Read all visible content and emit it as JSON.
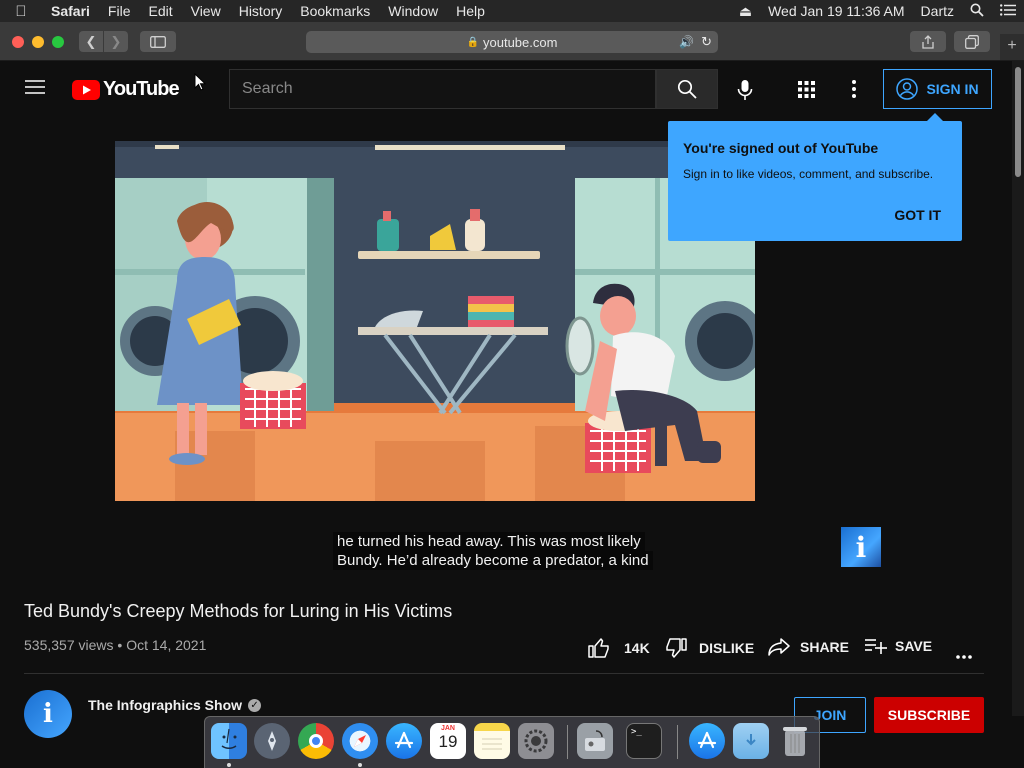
{
  "menubar": {
    "app": "Safari",
    "items": [
      "File",
      "Edit",
      "View",
      "History",
      "Bookmarks",
      "Window",
      "Help"
    ],
    "clock": "Wed Jan 19  11:36 AM",
    "user": "Dartz"
  },
  "browser": {
    "url": "youtube.com"
  },
  "youtube": {
    "logo_text": "YouTube",
    "search_placeholder": "Search",
    "sign_in_label": "SIGN IN"
  },
  "popup": {
    "heading": "You're signed out of YouTube",
    "body": "Sign in to like videos, comment, and subscribe.",
    "button": "GOT IT"
  },
  "video": {
    "caption_line1": "he turned his head away. This was most likely",
    "caption_line2": "Bundy. He’d already become a predator, a kind",
    "title": "Ted Bundy's Creepy Methods for Luring in His Victims",
    "views": "535,357 views",
    "date": "Oct 14, 2021",
    "likes": "14K",
    "dislike_label": "DISLIKE",
    "share_label": "SHARE",
    "save_label": "SAVE"
  },
  "channel": {
    "name": "The Infographics Show",
    "join_label": "JOIN",
    "subscribe_label": "SUBSCRIBE"
  },
  "dock": {
    "calendar_month": "JAN",
    "calendar_day": "19"
  },
  "colors": {
    "accent_blue": "#3ea6ff",
    "youtube_red": "#ff0000"
  }
}
